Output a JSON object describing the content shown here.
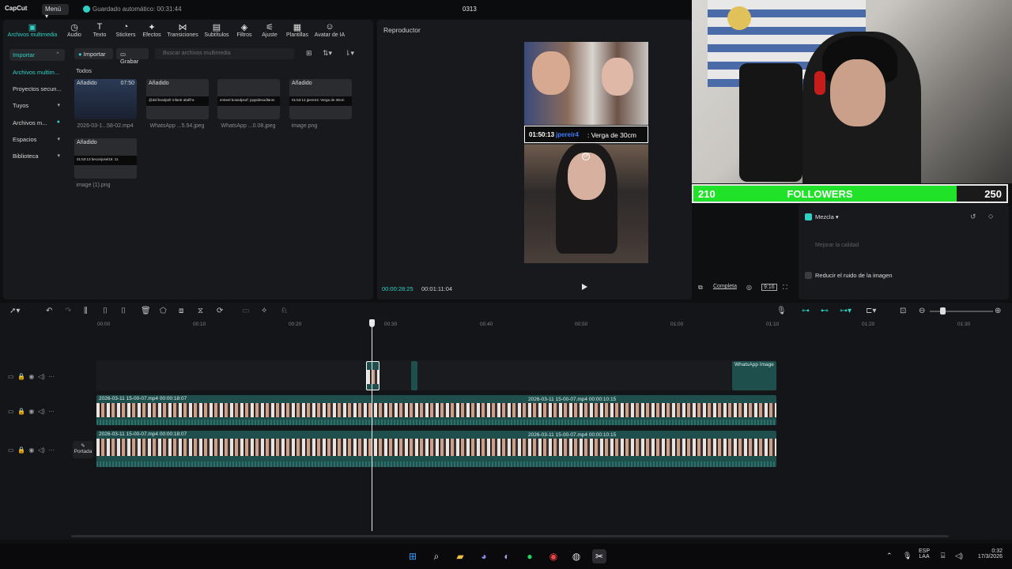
{
  "app": {
    "logo": "CapCut",
    "menu": "Menú ▾",
    "autosave": "Guardado automático: 00:31:44",
    "project": "0313"
  },
  "toolbar_tabs": [
    {
      "label": "Archivos multimedia",
      "icon": "media-icon",
      "active": true
    },
    {
      "label": "Audio",
      "icon": "audio-icon"
    },
    {
      "label": "Texto",
      "icon": "text-icon"
    },
    {
      "label": "Stickers",
      "icon": "sticker-icon"
    },
    {
      "label": "Efectos",
      "icon": "effects-icon"
    },
    {
      "label": "Transiciones",
      "icon": "transitions-icon"
    },
    {
      "label": "Subtítulos",
      "icon": "subtitles-icon"
    },
    {
      "label": "Filtros",
      "icon": "filters-icon"
    },
    {
      "label": "Ajuste",
      "icon": "adjust-icon"
    },
    {
      "label": "Plantillas",
      "icon": "templates-icon"
    },
    {
      "label": "Avatar de IA",
      "icon": "ai-avatar-icon"
    }
  ],
  "sidebar": {
    "items": [
      {
        "label": "Importar"
      },
      {
        "label": "Archivos multim..."
      },
      {
        "label": "Proyectos secun..."
      },
      {
        "label": "Tuyos"
      },
      {
        "label": "Archivos m..."
      },
      {
        "label": "Espacios"
      },
      {
        "label": "Biblioteca"
      }
    ]
  },
  "media": {
    "import": "Importar",
    "record": "Grabar",
    "search_placeholder": "Buscar archivos multimedia",
    "section": "Todos",
    "items": [
      {
        "badge": "Añadido",
        "duration": "07:50",
        "caption": "2026-03-1...58-02.mp4",
        "strip": ""
      },
      {
        "badge": "Añadido",
        "duration": "",
        "caption": "WhatsApp ...5.54.jpeg",
        "strip": "@dsf:bssdpsfr infantr abdfr'a"
      },
      {
        "badge": "",
        "duration": "",
        "caption": "WhatsApp ...0.08.jpeg",
        "strip": "ersteel bosedpsof: joppidesodlanm"
      },
      {
        "badge": "Añadido",
        "duration": "",
        "caption": "image.png",
        "strip": "01:53:13 jpereir4: Verga de 30cm"
      },
      {
        "badge": "Añadido",
        "duration": "",
        "caption": "image (1).png",
        "strip": "01:53:13 beconjosel15: 11"
      }
    ]
  },
  "player": {
    "title": "Reproductor",
    "caption_time": "01:50:13",
    "caption_user": "jpereir4",
    "caption_msg": ": Verga de 30cm",
    "time_current": "00:00:28:25",
    "time_total": "00:01:11:04",
    "ratio": "Completa",
    "aspect": "9:16"
  },
  "overlay": {
    "current": "210",
    "label": "FOLLOWERS",
    "goal": "250",
    "progress": 0.84
  },
  "props": {
    "mix": "Mezcla ▾",
    "enhance": "Mejorar la calidad",
    "denoise": "Reducir el ruido de la imagen"
  },
  "timeline": {
    "ticks": [
      "00:00",
      "00:10",
      "00:20",
      "00:30",
      "00:40",
      "00:50",
      "01:00",
      "01:10",
      "01:20",
      "01:30"
    ],
    "portada": "Portada",
    "overlay_clip": "WhatsApp Image",
    "clip_a": "2026-03-11 15-00-07.mp4   00:00:18:07",
    "clip_b": "2026-03-11 15-00-07.mp4   00:00:10:15"
  },
  "taskbar": {
    "lang1": "ESP",
    "lang2": "LAA",
    "time": "0:32",
    "date": "17/3/2026"
  }
}
